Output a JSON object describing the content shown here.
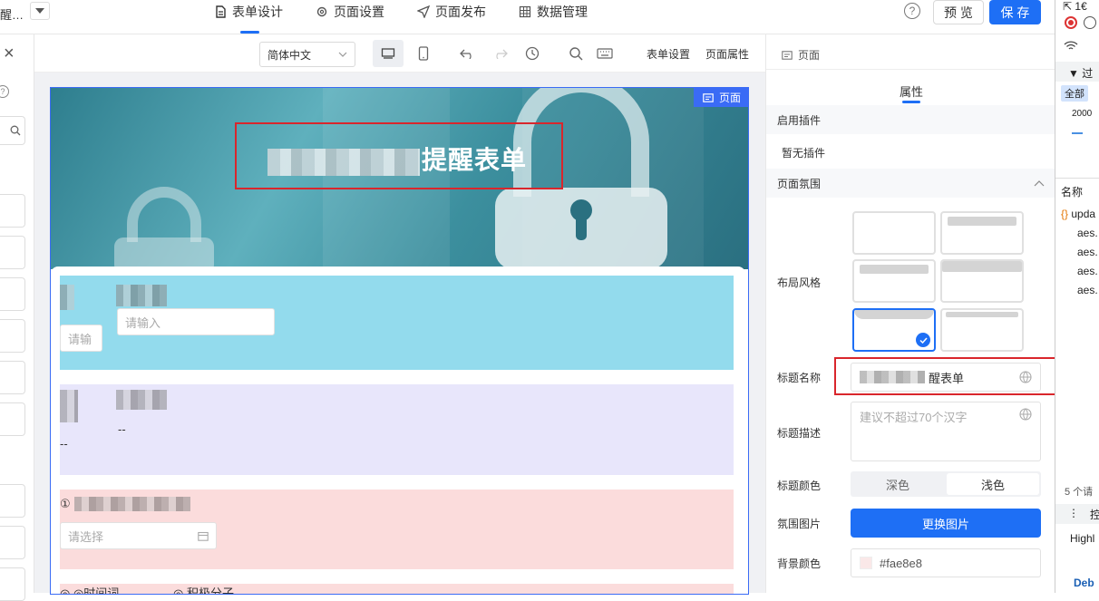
{
  "topbar": {
    "breadcrumb": "醒…",
    "tabs": [
      {
        "label": "表单设计",
        "icon": "document-icon",
        "active": true
      },
      {
        "label": "页面设置",
        "icon": "gear-icon"
      },
      {
        "label": "页面发布",
        "icon": "send-icon"
      },
      {
        "label": "数据管理",
        "icon": "grid-icon"
      }
    ],
    "help": "?",
    "preview_label": "预 览",
    "save_label": "保 存"
  },
  "toolbar": {
    "language": "简体中文",
    "form_settings": "表单设置",
    "page_props": "页面属性"
  },
  "canvas": {
    "page_tag": "页面",
    "title_suffix": "提醒表单",
    "fields": [
      {
        "placeholder": "请输入",
        "side_label": "请输"
      },
      {
        "dash1": "--",
        "dash2": "--"
      },
      {
        "prefix": "①",
        "placeholder": "请选择"
      },
      {
        "text1": "◎ ◎时间词",
        "text2": "◎ 积极分子"
      }
    ]
  },
  "props": {
    "breadcrumb": "页面",
    "tab": "属性",
    "plugins_header": "启用插件",
    "no_plugins": "暂无插件",
    "atmosphere_header": "页面氛围",
    "layout_label": "布局风格",
    "title_name_label": "标题名称",
    "title_name_value": "醒表单",
    "title_desc_label": "标题描述",
    "title_desc_placeholder": "建议不超过70个汉字",
    "title_color_label": "标题颜色",
    "color_dark": "深色",
    "color_light": "浅色",
    "atmos_image_label": "氛围图片",
    "change_image": "更换图片",
    "bg_color_label": "背景颜色",
    "bg_color_value": "#fae8e8",
    "colors": {
      "accent": "#1e6ff5",
      "bg_swatch": "#fae8e8"
    }
  },
  "devtools": {
    "top_num": "1€",
    "filter": "过",
    "all": "全部",
    "row_2000": "2000",
    "name_header": "名称",
    "items": [
      "upda",
      "aes.",
      "aes.",
      "aes.",
      "aes."
    ],
    "requests": "5 个请",
    "console": "控",
    "highlight": "Highl",
    "debug": "Deb"
  },
  "left": {
    "close": "×",
    "help": "?"
  }
}
